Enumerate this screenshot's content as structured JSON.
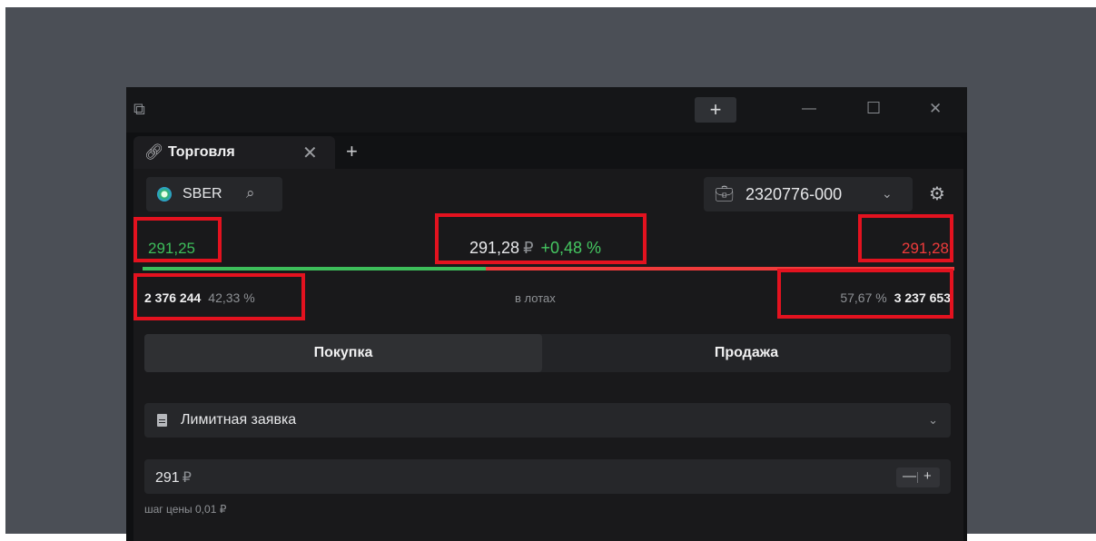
{
  "window": {
    "new_button_label": "+",
    "minimize_label": "—",
    "maximize_label": "☐",
    "close_label": "✕"
  },
  "tab": {
    "title": "Торговля",
    "close_label": "✕",
    "add_label": "+"
  },
  "instrument": {
    "ticker": "SBER",
    "account": "2320776-000"
  },
  "prices": {
    "bid": "291,25",
    "last": "291,28",
    "currency": "₽",
    "change": "+0,48 %",
    "ask": "291,28"
  },
  "orderbook": {
    "buy_volume": "2 376 244",
    "buy_percent": "42,33 %",
    "buy_share": 0.4233,
    "lots_label": "в лотах",
    "sell_percent": "57,67 %",
    "sell_volume": "3 237 653"
  },
  "side": {
    "buy_label": "Покупка",
    "sell_label": "Продажа",
    "selected": "buy"
  },
  "order": {
    "type_label": "Лимитная заявка",
    "price_value": "291",
    "price_currency": "₽",
    "minus_label": "—",
    "plus_label": "+",
    "step_hint": "шаг цены 0,01 ₽"
  },
  "colors": {
    "buy_green": "#3dbd5a",
    "sell_red": "#ef3b3b",
    "highlight_red": "#e3121f"
  }
}
